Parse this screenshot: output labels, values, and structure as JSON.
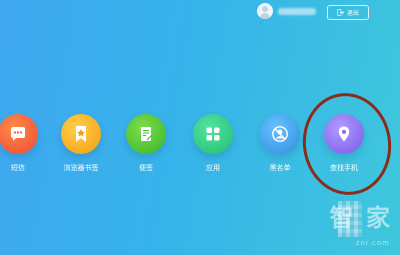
{
  "header": {
    "logout_label": "退出"
  },
  "apps": [
    {
      "id": "sms",
      "label": "短信",
      "icon": "message-dots-icon",
      "color": "#f05a3c"
    },
    {
      "id": "bookmarks",
      "label": "浏览器书签",
      "icon": "star-bookmark-icon",
      "color": "#f6b01e"
    },
    {
      "id": "notes",
      "label": "便签",
      "icon": "note-icon",
      "color": "#4fc33a"
    },
    {
      "id": "apps",
      "label": "应用",
      "icon": "grid-icon",
      "color": "#2fd08a"
    },
    {
      "id": "blacklist",
      "label": "黑名单",
      "icon": "block-user-icon",
      "color": "#3ea0ec"
    },
    {
      "id": "findphone",
      "label": "查找手机",
      "icon": "location-pin-icon",
      "color": "#8a6cf0"
    }
  ],
  "watermark": {
    "text": "智 家",
    "url": "zni.com"
  }
}
